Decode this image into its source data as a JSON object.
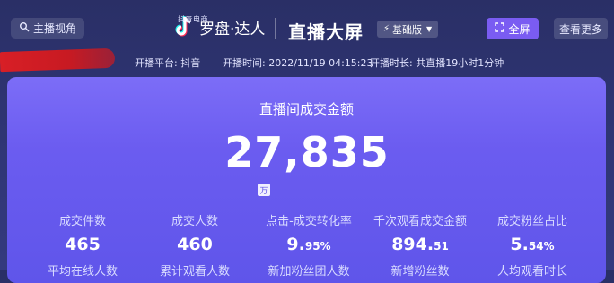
{
  "header": {
    "host_view_label": "主播视角",
    "logo_small": "抖音电商",
    "logo_big": "罗盘·达人",
    "title": "直播大屏",
    "edition": "基础版",
    "fullscreen_label": "全屏",
    "more_label": "查看更多"
  },
  "meta": {
    "platform": "开播平台: 抖音",
    "start_time": "开播时间: 2022/11/19 04:15:23",
    "duration": "开播时长: 共直播19小时1分钟"
  },
  "main": {
    "title": "直播间成交金额",
    "amount": "27,835",
    "unit": "万"
  },
  "stats": [
    {
      "label": "成交件数",
      "value": "465",
      "decimal": ""
    },
    {
      "label": "成交人数",
      "value": "460",
      "decimal": ""
    },
    {
      "label": "点击-成交转化率",
      "value": "9.",
      "decimal": "95%"
    },
    {
      "label": "千次观看成交金额",
      "value": "894.",
      "decimal": "51"
    },
    {
      "label": "成交粉丝占比",
      "value": "5.",
      "decimal": "54%"
    }
  ],
  "stats_next_row": [
    "平均在线人数",
    "累计观看人数",
    "新加粉丝团人数",
    "新增粉丝数",
    "人均观看时长"
  ],
  "colors": {
    "fullscreen_button": "#7a5cf2",
    "card_top": "#7c6df7",
    "card_bottom": "#5f55ea",
    "redaction": "#d81f26"
  },
  "icons": [
    "host-view-icon",
    "tiktok-logo-icon",
    "lightning-icon",
    "chevron-down-icon",
    "fullscreen-icon"
  ]
}
